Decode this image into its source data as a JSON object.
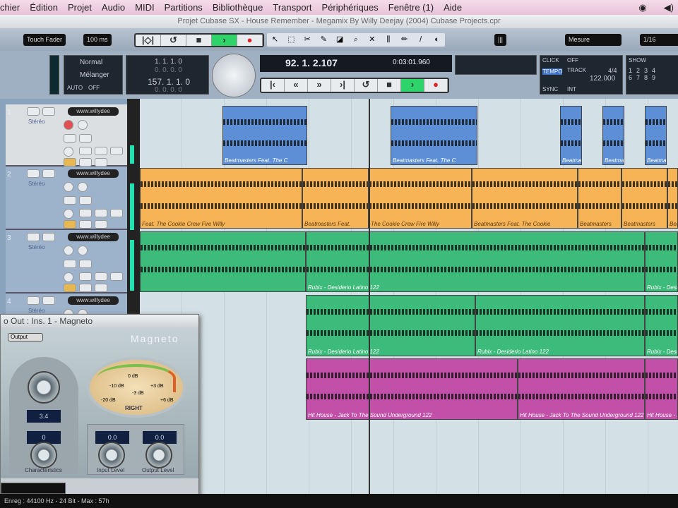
{
  "menu": [
    "chier",
    "Édition",
    "Projet",
    "Audio",
    "MIDI",
    "Partitions",
    "Bibliothèque",
    "Transport",
    "Périphériques",
    "Fenêtre (1)",
    "Aide"
  ],
  "window_title": "Projet Cubase SX - House Remember - Megamix By Willy Deejay (2004) Cubase Projects.cpr",
  "toolbar": {
    "automation_mode": "Touch Fader",
    "preroll": "100 ms",
    "grid": "Mesure",
    "quantize": "1/16",
    "snap": "|||"
  },
  "transport": {
    "mode1": "Normal",
    "mode2": "Mélanger",
    "auto": "AUTO",
    "auto_val": "OFF",
    "left_locator": "1. 1. 1.   0",
    "right_locator": "157. 1. 1.   0",
    "offset": "0. 0. 0.   0",
    "position_bars": "92. 1. 2.107",
    "position_time": "0:03:01.960",
    "click": "CLICK",
    "click_val": "OFF",
    "tempo_label": "TEMPO",
    "track_label": "TRACK",
    "signature": "4/4",
    "tempo": "122.000",
    "sync": "SYNC",
    "sync_val": "INT",
    "show": "SHOW"
  },
  "tracks": [
    {
      "num": "1",
      "name": "www.willydee",
      "type": "Stéréo"
    },
    {
      "num": "2",
      "name": "www.willydee",
      "type": "Stéréo"
    },
    {
      "num": "3",
      "name": "www.willydee",
      "type": "Stéréo"
    },
    {
      "num": "4",
      "name": "www.willydee",
      "type": "Stéréo"
    }
  ],
  "events": {
    "t1": "Beatmasters Feat. The C",
    "t2a": "Feat. The Cookie Crew Fire Willy",
    "t2b": "Beatmasters Feat.",
    "t2c": "The Cookie Crew Fire Willy",
    "t2d": "Beatmasters Feat. The Cookie",
    "t2e": "Beatmasters",
    "t3": "Rubix - Desiderio Latino 122",
    "t4": "Rubix - Desiderio Latino 122",
    "t5": "Hit House - Jack To The Sound Underground 122"
  },
  "plugin": {
    "title": "o Out : Ins. 1 - Magneto",
    "brand": "Magneto",
    "output_btn": "Output",
    "drive": "3.4",
    "meter_label": "RIGHT",
    "char_val": "0",
    "in_val": "0.0",
    "out_val": "0.0",
    "char_label": "Characteristics",
    "in_label": "Input Level",
    "out_label": "Output Level",
    "meter_marks": [
      "-10 dB",
      "-3 dB",
      "0 dB",
      "+3 dB",
      "-20 dB",
      "+6 dB"
    ]
  },
  "status": "Enreg : 44100 Hz - 24 Bit - Max : 57h",
  "colors": {
    "blue": "#5c8fd6",
    "orange": "#f7b457",
    "green": "#3dbb7a",
    "magenta": "#c350a8"
  }
}
